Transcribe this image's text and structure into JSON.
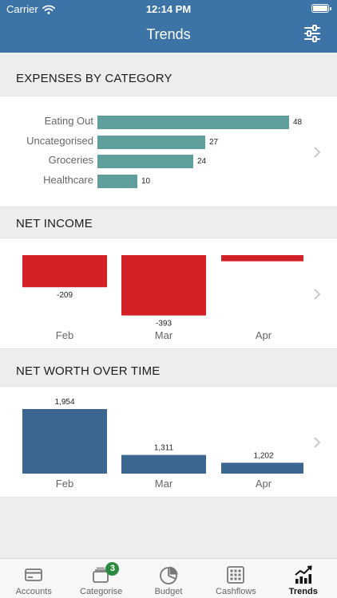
{
  "status": {
    "carrier": "Carrier",
    "time": "12:14 PM"
  },
  "header": {
    "title": "Trends"
  },
  "sections": {
    "expenses": {
      "title": "EXPENSES BY CATEGORY"
    },
    "net_income": {
      "title": "NET INCOME"
    },
    "net_worth": {
      "title": "NET WORTH OVER TIME"
    }
  },
  "chart_data": [
    {
      "type": "bar",
      "orientation": "horizontal",
      "title": "EXPENSES BY CATEGORY",
      "categories": [
        "Eating Out",
        "Uncategorised",
        "Groceries",
        "Healthcare"
      ],
      "values": [
        48,
        27,
        24,
        10
      ],
      "labels": [
        "48",
        "27",
        "24",
        "10"
      ],
      "color": "#5f9e9b"
    },
    {
      "type": "bar",
      "title": "NET INCOME",
      "categories": [
        "Feb",
        "Mar",
        "Apr"
      ],
      "values": [
        -209,
        -393,
        -40
      ],
      "labels": [
        "-209",
        "-393",
        ""
      ],
      "ylim": [
        -400,
        0
      ],
      "color": "#d42027"
    },
    {
      "type": "bar",
      "title": "NET WORTH OVER TIME",
      "categories": [
        "Feb",
        "Mar",
        "Apr"
      ],
      "values": [
        1954,
        1311,
        1202
      ],
      "labels": [
        "1,954",
        "1,311",
        "1,202"
      ],
      "ylim": [
        1050,
        2000
      ],
      "color": "#3b6690"
    }
  ],
  "tabs": [
    {
      "label": "Accounts",
      "icon": "credit-card-icon",
      "active": false
    },
    {
      "label": "Categorise",
      "icon": "stack-icon",
      "badge": "3",
      "active": false
    },
    {
      "label": "Budget",
      "icon": "pie-chart-icon",
      "active": false
    },
    {
      "label": "Cashflows",
      "icon": "calendar-grid-icon",
      "active": false
    },
    {
      "label": "Trends",
      "icon": "trend-chart-icon",
      "active": true
    }
  ]
}
